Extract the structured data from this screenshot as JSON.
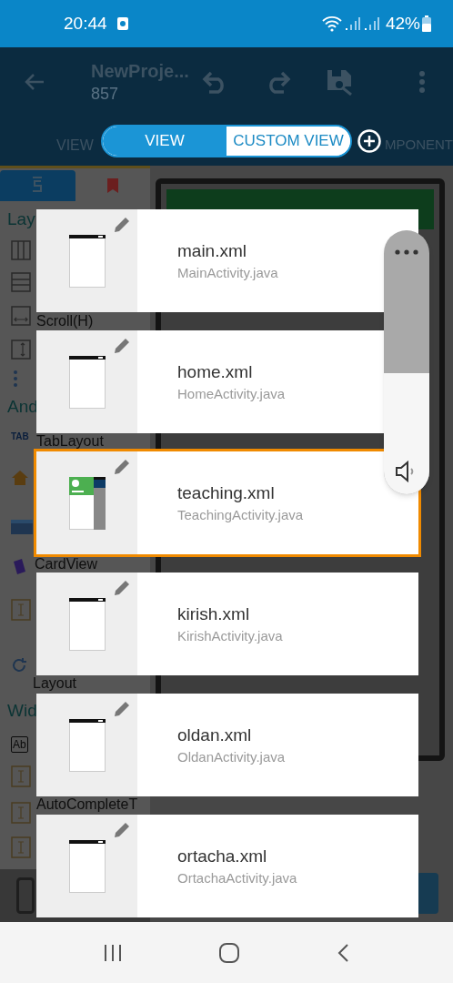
{
  "status_bar": {
    "time": "20:44",
    "battery": "42%"
  },
  "toolbar": {
    "title": "NewProje...",
    "subtitle": "857"
  },
  "view_tabs": {
    "left_label": "VIEW",
    "right_label": "MPONENT",
    "toggle": [
      {
        "label": "VIEW",
        "selected": true
      },
      {
        "label": "CUSTOM VIEW",
        "selected": false
      }
    ]
  },
  "palette": {
    "tabs": [
      {
        "kind": "source",
        "selected": true
      },
      {
        "kind": "bookmark",
        "selected": false
      }
    ],
    "sections": [
      {
        "title": "Lay",
        "items": [
          {
            "kind": "columns"
          },
          {
            "kind": "rows"
          },
          {
            "kind": "hscroll",
            "label": "Scroll(H)"
          },
          {
            "kind": "vscroll"
          },
          {
            "kind": "progress"
          }
        ]
      },
      {
        "title": "And",
        "items": [
          {
            "kind": "tab",
            "icon_text": "TAB",
            "label": "TabLayout"
          },
          {
            "kind": "home"
          },
          {
            "kind": "toolbar"
          },
          {
            "kind": "card",
            "label": "CardView"
          },
          {
            "kind": "text"
          },
          {
            "kind": "refresh",
            "label": "Layout"
          }
        ]
      },
      {
        "title": "Wid",
        "items": [
          {
            "kind": "ab",
            "icon_text": "Ab"
          },
          {
            "kind": "text"
          },
          {
            "kind": "text",
            "label": "AutoCompleteT"
          },
          {
            "kind": "text"
          }
        ]
      }
    ]
  },
  "files": [
    {
      "name": "main.xml",
      "activity": "MainActivity.java",
      "kind": "blank",
      "selected": false
    },
    {
      "name": "home.xml",
      "activity": "HomeActivity.java",
      "kind": "blank",
      "selected": false
    },
    {
      "name": "teaching.xml",
      "activity": "TeachingActivity.java",
      "kind": "drawer",
      "selected": true
    },
    {
      "name": "kirish.xml",
      "activity": "KirishActivity.java",
      "kind": "blank",
      "selected": false
    },
    {
      "name": "oldan.xml",
      "activity": "OldanActivity.java",
      "kind": "blank",
      "selected": false
    },
    {
      "name": "ortacha.xml",
      "activity": "OrtachaActivity.java",
      "kind": "blank",
      "selected": false
    }
  ],
  "volume": {
    "level": 0.46
  }
}
